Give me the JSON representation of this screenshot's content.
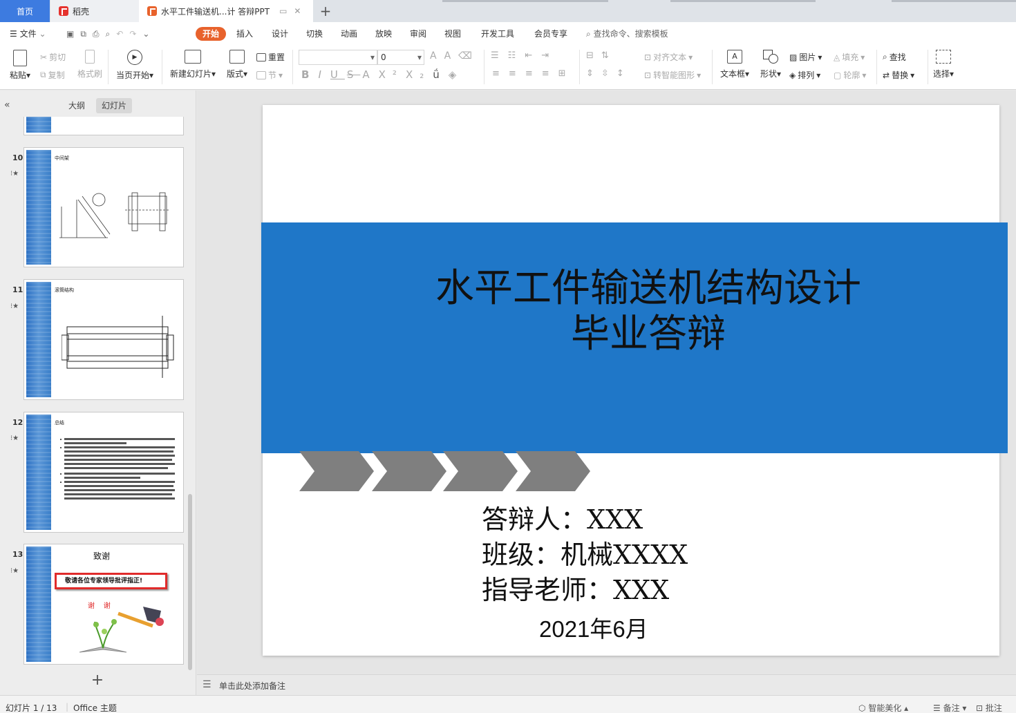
{
  "tabs": {
    "home": "首页",
    "doc1": "稻壳",
    "doc2": "水平工件输送机...计 答辩PPT"
  },
  "menu": {
    "file": "文件",
    "items": [
      "开始",
      "插入",
      "设计",
      "切换",
      "动画",
      "放映",
      "审阅",
      "视图",
      "开发工具",
      "会员专享"
    ],
    "search": "查找命令、搜索模板"
  },
  "ribbon": {
    "paste": "粘贴",
    "cut": "剪切",
    "copy": "复制",
    "format_painter": "格式刷",
    "from_start": "当页开始",
    "new_slide": "新建幻灯片",
    "layout": "版式",
    "reset": "重置",
    "section": "节",
    "font_name": "",
    "font_size": "0",
    "align_text": "对齐文本",
    "smart_shape": "转智能图形",
    "textbox": "文本框",
    "shape": "形状",
    "picture": "图片",
    "arrange": "排列",
    "fill": "填充",
    "outline": "轮廓",
    "find": "查找",
    "replace": "替换",
    "select": "选择"
  },
  "panel": {
    "outline_tab": "大纲",
    "slides_tab": "幻灯片",
    "thumbs": [
      {
        "num": "10",
        "title": "中间架"
      },
      {
        "num": "11",
        "title": "滚筒结构"
      },
      {
        "num": "12",
        "title": "总结"
      },
      {
        "num": "13",
        "title": "致谢",
        "banner": "敬请各位专家领导批评指正!",
        "thanks": "谢    谢"
      }
    ]
  },
  "slide": {
    "title_line1": "水平工件输送机结构设计",
    "title_line2": "毕业答辩",
    "presenter": "答辩人：XXX",
    "class": "班级：机械XXXX",
    "advisor": "指导老师：XXX",
    "date": "2021年6月",
    "band_color": "#1f77c8",
    "chevron_color": "#7f7f7f"
  },
  "notes": {
    "placeholder": "单击此处添加备注"
  },
  "status": {
    "slide_counter": "幻灯片 1 / 13",
    "theme": "Office 主题",
    "beautify": "智能美化",
    "notes_btn": "备注",
    "comment_btn": "批注"
  }
}
